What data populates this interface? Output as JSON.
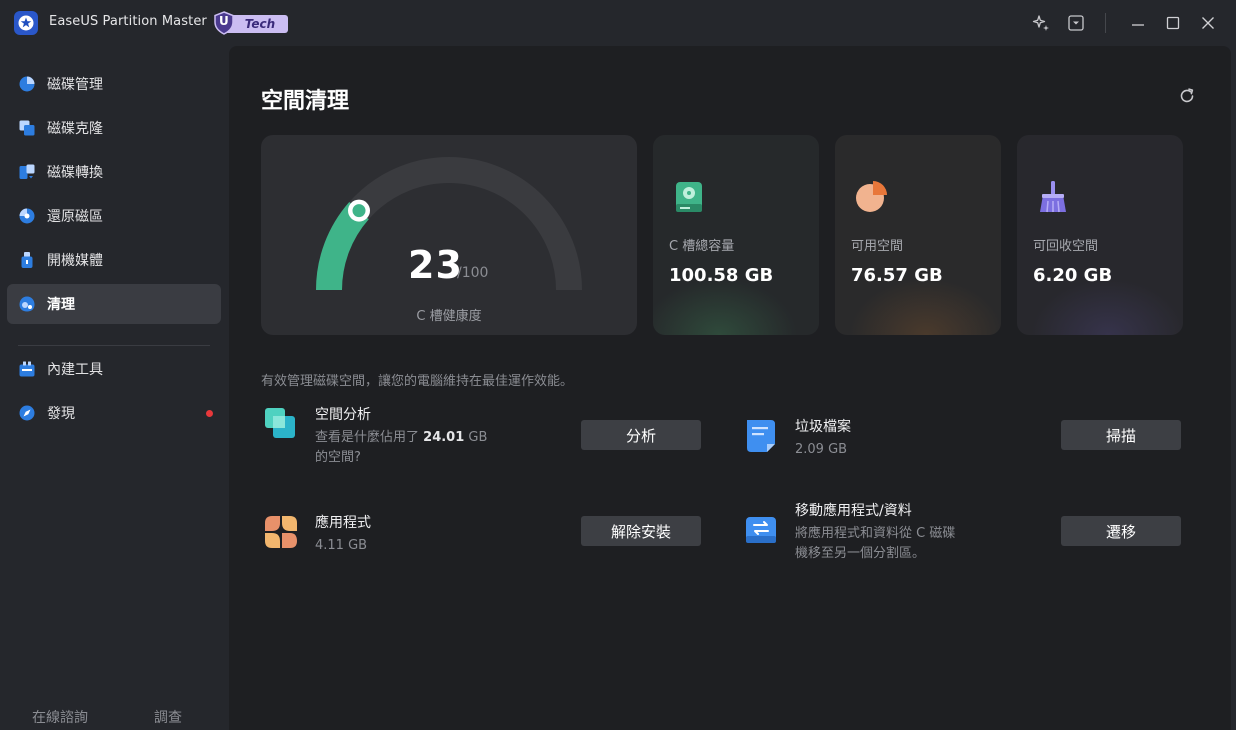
{
  "app": {
    "title": "EaseUS Partition Master",
    "badge_letter": "U",
    "badge_text": "Tech"
  },
  "sidebar": {
    "items": [
      {
        "label": "磁碟管理",
        "icon": "pie-chart-icon"
      },
      {
        "label": "磁碟克隆",
        "icon": "clone-icon"
      },
      {
        "label": "磁碟轉換",
        "icon": "convert-icon"
      },
      {
        "label": "還原磁區",
        "icon": "recover-icon"
      },
      {
        "label": "開機媒體",
        "icon": "usb-icon"
      },
      {
        "label": "清理",
        "icon": "cleanup-icon",
        "active": true
      },
      {
        "label": "內建工具",
        "icon": "toolbox-icon"
      },
      {
        "label": "發現",
        "icon": "compass-icon",
        "notification": true
      }
    ],
    "footer": {
      "consult": "在線諮詢",
      "survey": "調查"
    }
  },
  "main": {
    "title": "空間清理",
    "health": {
      "score": "23",
      "max": "/100",
      "label": "C 槽健康度",
      "value_fraction": 0.23
    },
    "stats": [
      {
        "label": "C 槽總容量",
        "value": "100.58 GB",
        "icon": "disk-icon",
        "accent": "#3fb489"
      },
      {
        "label": "可用空間",
        "value": "76.57 GB",
        "icon": "pie-icon",
        "accent": "#e8773a"
      },
      {
        "label": "可回收空間",
        "value": "6.20 GB",
        "icon": "broom-icon",
        "accent": "#7c6fe0"
      }
    ],
    "tagline": "有效管理磁碟空間，讓您的電腦維持在最佳運作效能。",
    "tools": {
      "space_analysis": {
        "name": "空間分析",
        "desc_prefix": "查看是什麼佔用了",
        "desc_amount": "24.01",
        "desc_unit": "GB",
        "desc_suffix": "的空間?",
        "button": "分析"
      },
      "junk_files": {
        "name": "垃圾檔案",
        "desc": "2.09 GB",
        "button": "掃描"
      },
      "apps": {
        "name": "應用程式",
        "desc": "4.11 GB",
        "button": "解除安裝"
      },
      "migrate": {
        "name": "移動應用程式/資料",
        "desc_line1": "將應用程式和資料從 C 磁碟",
        "desc_line2": "機移至另一個分割區。",
        "button": "遷移"
      }
    }
  }
}
